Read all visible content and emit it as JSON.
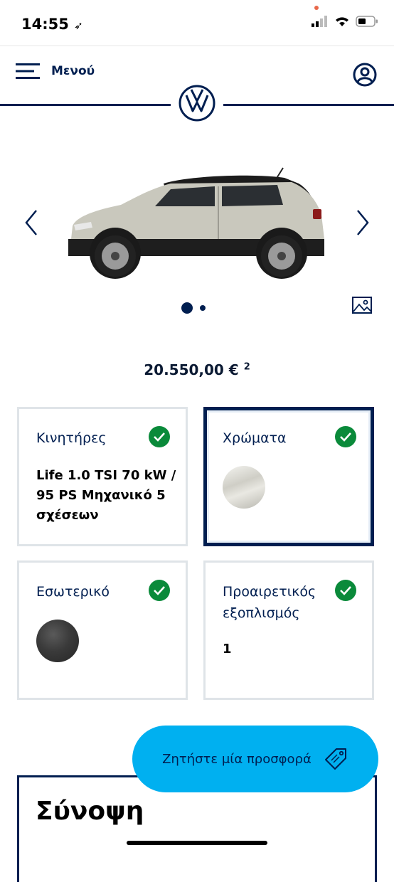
{
  "status_bar": {
    "time": "14:55"
  },
  "nav": {
    "menu_label": "Μενού"
  },
  "price": {
    "amount": "20.550,00 €",
    "footnote": "2"
  },
  "cards": {
    "engine": {
      "title": "Κινητήρες",
      "value": "Life 1.0 TSI 70 kW / 95 PS Μηχανικό 5 σχέσεων"
    },
    "colors": {
      "title": "Χρώματα"
    },
    "interior": {
      "title": "Εσωτερικό"
    },
    "optional": {
      "title": "Προαιρετικός εξοπλισμός",
      "value": "1"
    }
  },
  "cta": {
    "label": "Ζητήστε μία προσφορά"
  },
  "summary": {
    "title": "Σύνοψη"
  },
  "colors": {
    "brand_navy": "#001e50",
    "cta_blue": "#00b0f0",
    "check_green": "#0a8a3a",
    "card_border": "#dfe4e8"
  },
  "icons": [
    "location-arrow-icon",
    "signal-icon",
    "wifi-icon",
    "battery-icon",
    "menu-icon",
    "user-icon",
    "vw-logo",
    "chevron-left-icon",
    "chevron-right-icon",
    "gallery-icon",
    "check-icon",
    "tag-icon"
  ]
}
